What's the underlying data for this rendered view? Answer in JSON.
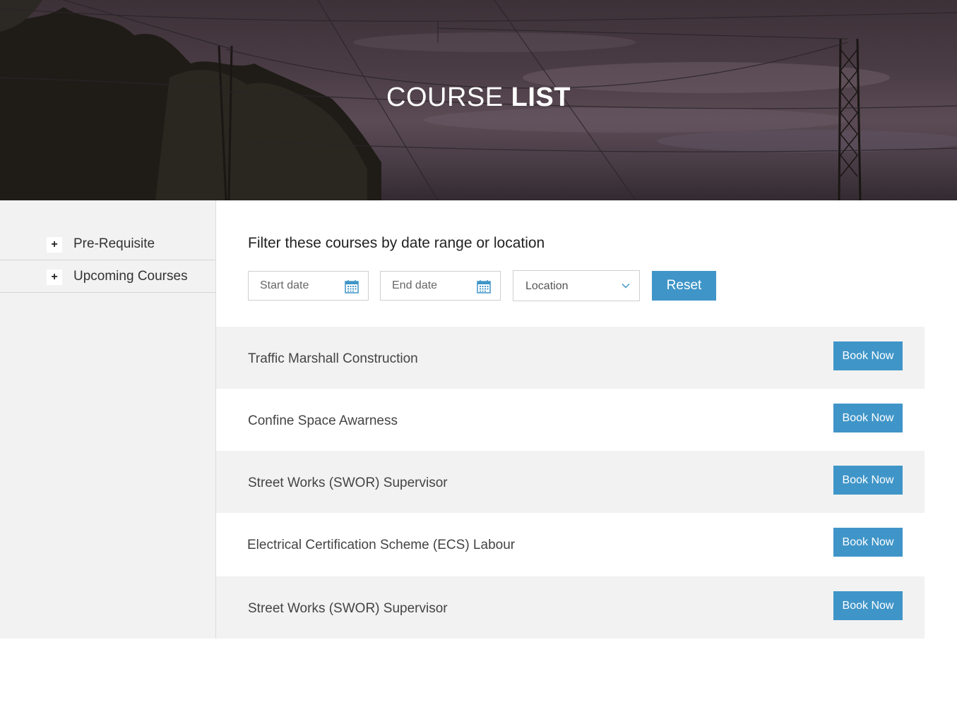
{
  "hero": {
    "title_light": "COURSE",
    "title_bold": "LIST"
  },
  "sidebar": {
    "items": [
      {
        "icon": "plus-icon",
        "label": "Pre-Requisite"
      },
      {
        "icon": "plus-icon",
        "label": "Upcoming Courses"
      }
    ]
  },
  "filter": {
    "title": "Filter these courses by date range or location",
    "start_placeholder": "Start date",
    "end_placeholder": "End date",
    "location_value": "Location",
    "reset_label": "Reset"
  },
  "courses": [
    {
      "name": "Traffic Marshall Construction",
      "button": "Book Now"
    },
    {
      "name": "Confine Space Awarness",
      "button": "Book Now"
    },
    {
      "name": "Street Works (SWOR) Supervisor",
      "button": "Book Now"
    },
    {
      "name": "Electrical Certification Scheme (ECS) Labour",
      "button": "Book Now"
    },
    {
      "name": "Street Works (SWOR) Supervisor",
      "button": "Book Now"
    }
  ],
  "colors": {
    "accent": "#3f95c8",
    "row_grey": "#f2f2f2",
    "sidebar_bg": "#f2f2f2"
  }
}
